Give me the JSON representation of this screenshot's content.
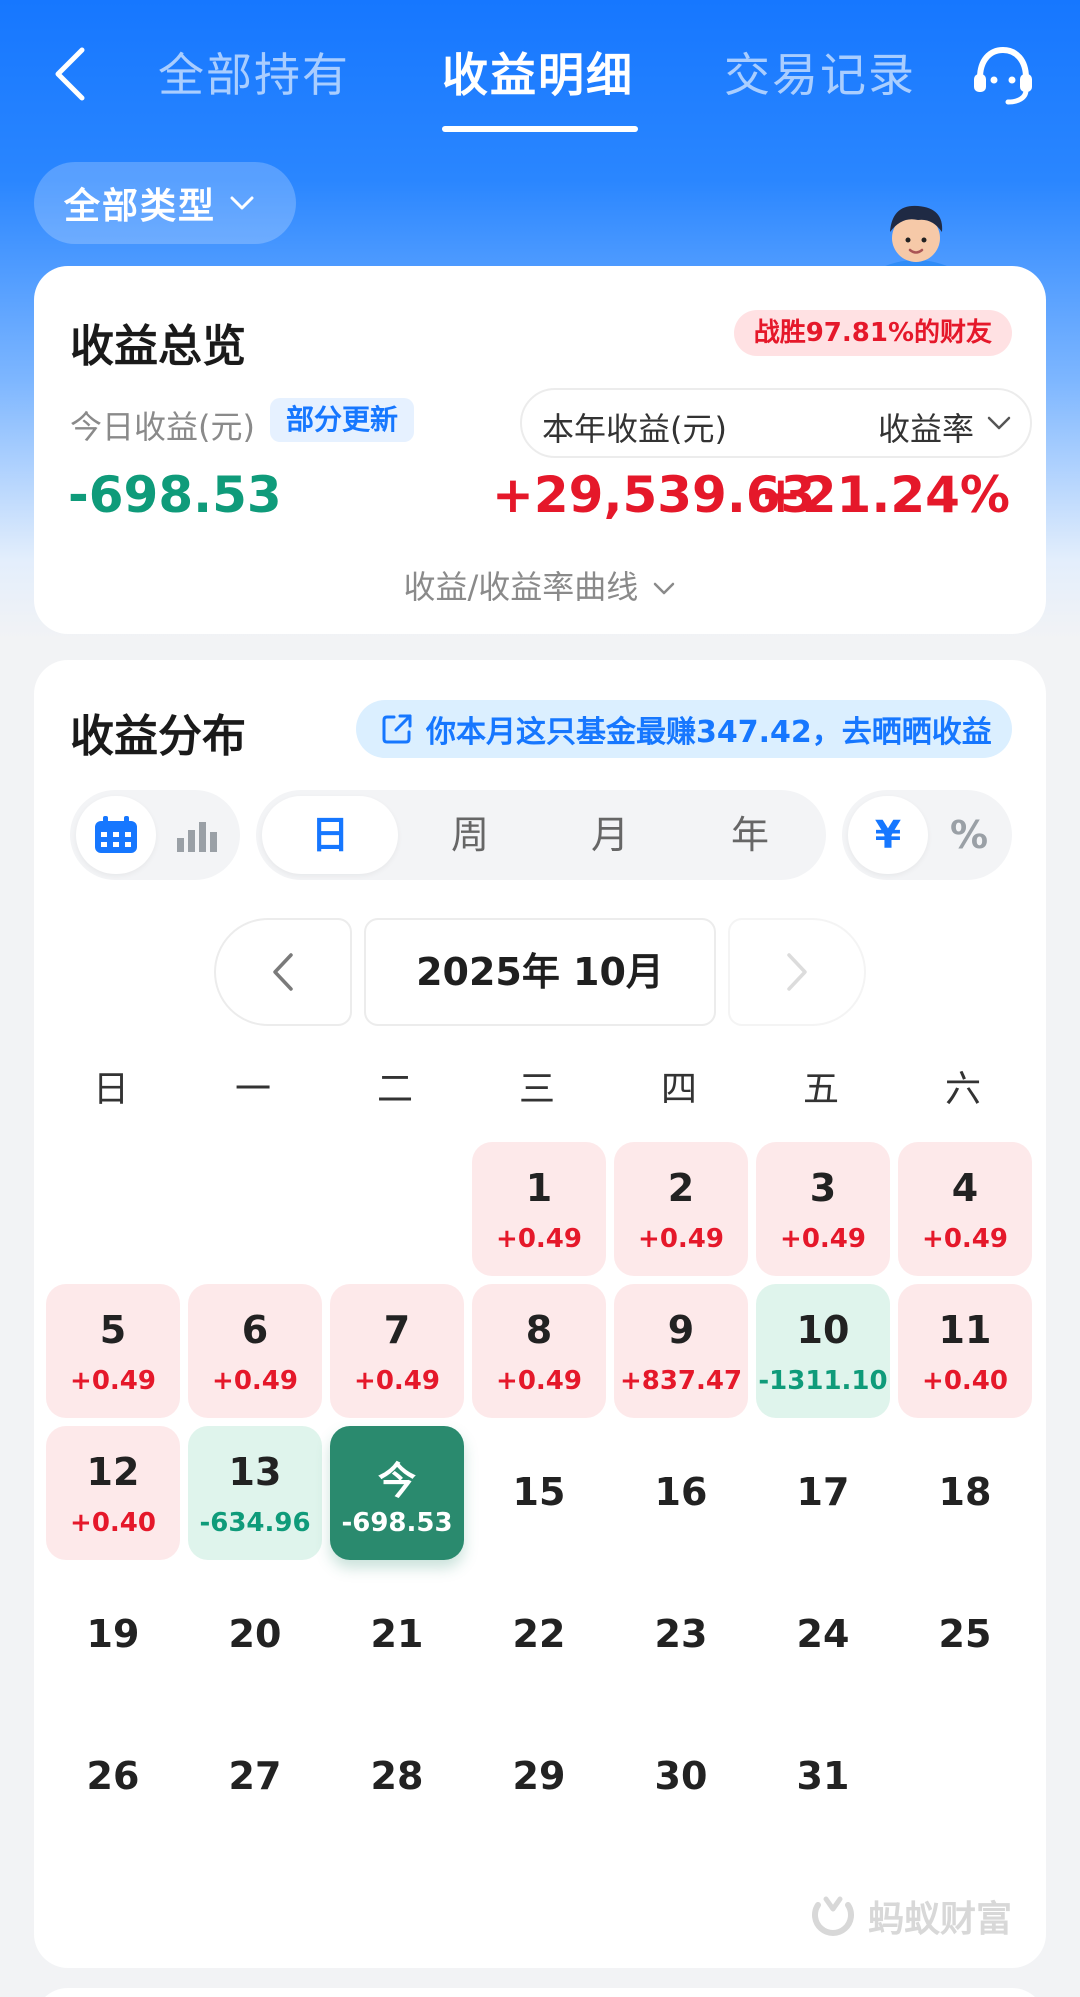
{
  "nav": {
    "tabs": [
      {
        "label": "全部持有",
        "active": false
      },
      {
        "label": "收益明细",
        "active": true
      },
      {
        "label": "交易记录",
        "active": false
      }
    ],
    "back_icon": "chevron-left-icon",
    "service_icon": "headset-icon"
  },
  "filter": {
    "label": "全部类型"
  },
  "overview": {
    "title": "收益总览",
    "win_badge": "战胜97.81%的财友",
    "today_label": "今日收益(元)",
    "update_badge": "部分更新",
    "today_value": "-698.53",
    "year_label": "本年收益(元)",
    "rate_label": "收益率",
    "year_value": "+29,539.63",
    "rate_value": "+21.24%",
    "curve_toggle": "收益/收益率曲线"
  },
  "distribution": {
    "title": "收益分布",
    "share_text": "你本月这只基金最赚347.42，去晒晒收益",
    "view_toggle": {
      "options": [
        "calendar-icon",
        "bar-chart-icon"
      ],
      "selected": 0
    },
    "period_tabs": {
      "options": [
        "日",
        "周",
        "月",
        "年"
      ],
      "selected": 0
    },
    "unit_toggle": {
      "options": [
        "¥",
        "%"
      ],
      "selected": 0
    },
    "month_label": "2025年 10月",
    "weekdays": [
      "日",
      "一",
      "二",
      "三",
      "四",
      "五",
      "六"
    ],
    "first_weekday": 3,
    "days": [
      {
        "label": "1",
        "value": "+0.49",
        "type": "pos"
      },
      {
        "label": "2",
        "value": "+0.49",
        "type": "pos"
      },
      {
        "label": "3",
        "value": "+0.49",
        "type": "pos"
      },
      {
        "label": "4",
        "value": "+0.49",
        "type": "pos"
      },
      {
        "label": "5",
        "value": "+0.49",
        "type": "pos"
      },
      {
        "label": "6",
        "value": "+0.49",
        "type": "pos"
      },
      {
        "label": "7",
        "value": "+0.49",
        "type": "pos"
      },
      {
        "label": "8",
        "value": "+0.49",
        "type": "pos"
      },
      {
        "label": "9",
        "value": "+837.47",
        "type": "pos"
      },
      {
        "label": "10",
        "value": "-1311.10",
        "type": "neg"
      },
      {
        "label": "11",
        "value": "+0.40",
        "type": "pos"
      },
      {
        "label": "12",
        "value": "+0.40",
        "type": "pos"
      },
      {
        "label": "13",
        "value": "-634.96",
        "type": "neg"
      },
      {
        "label": "今",
        "value": "-698.53",
        "type": "today"
      },
      {
        "label": "15",
        "value": "",
        "type": "plain"
      },
      {
        "label": "16",
        "value": "",
        "type": "plain"
      },
      {
        "label": "17",
        "value": "",
        "type": "plain"
      },
      {
        "label": "18",
        "value": "",
        "type": "plain"
      },
      {
        "label": "19",
        "value": "",
        "type": "plain"
      },
      {
        "label": "20",
        "value": "",
        "type": "plain"
      },
      {
        "label": "21",
        "value": "",
        "type": "plain"
      },
      {
        "label": "22",
        "value": "",
        "type": "plain"
      },
      {
        "label": "23",
        "value": "",
        "type": "plain"
      },
      {
        "label": "24",
        "value": "",
        "type": "plain"
      },
      {
        "label": "25",
        "value": "",
        "type": "plain"
      },
      {
        "label": "26",
        "value": "",
        "type": "plain"
      },
      {
        "label": "27",
        "value": "",
        "type": "plain"
      },
      {
        "label": "28",
        "value": "",
        "type": "plain"
      },
      {
        "label": "29",
        "value": "",
        "type": "plain"
      },
      {
        "label": "30",
        "value": "",
        "type": "plain"
      },
      {
        "label": "31",
        "value": "",
        "type": "plain"
      }
    ],
    "brand": "蚂蚁财富"
  },
  "colors": {
    "primary": "#1677ff",
    "positive": "#e5182a",
    "negative": "#0f9b7a",
    "today": "#2a8a6e"
  }
}
